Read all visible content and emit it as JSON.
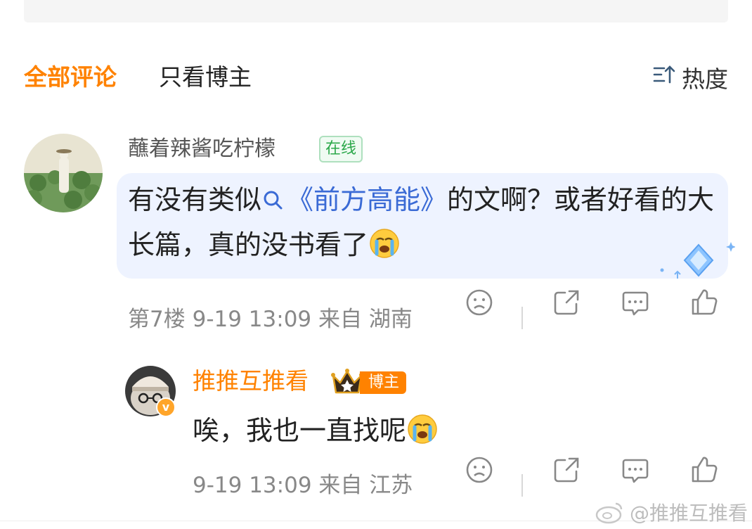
{
  "tabs": {
    "all": "全部评论",
    "op_only": "只看博主",
    "sort_label": "热度",
    "sort_icon": "sort-hot-icon"
  },
  "comment1": {
    "username": "蘸着辣酱吃柠檬",
    "online_badge": "在线",
    "text_before": "有没有类似",
    "topic": "《前方高能》",
    "text_after": "的文啊？或者好看的大长篇，真的没书看了",
    "emoji": "crying-emoji",
    "floor": "第7楼",
    "time": "9-19 13:09",
    "location": "来自 湖南"
  },
  "reply1": {
    "username": "推推互推看",
    "op_badge": "博主",
    "text": "唉，我也一直找呢",
    "emoji": "crying-emoji",
    "time": "9-19 13:09",
    "location": "来自 江苏"
  },
  "watermark": "@推推互推看",
  "colors": {
    "accent": "#ff8200",
    "topic_link": "#3a6ad5",
    "online_green": "#2ba84a",
    "bubble_bg": "#eef3ff"
  }
}
